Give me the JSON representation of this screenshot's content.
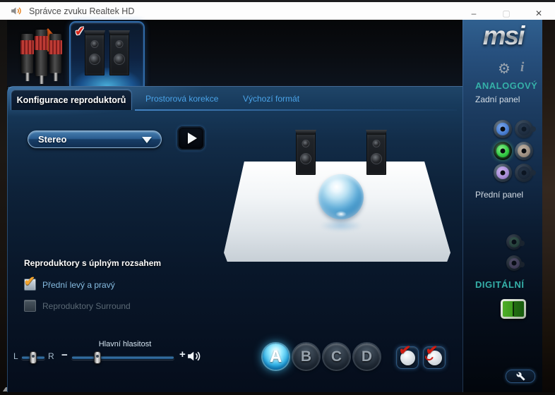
{
  "window": {
    "title": "Správce zvuku Realtek HD",
    "minimize_glyph": "–",
    "maximize_glyph": "▢",
    "close_glyph": "✕"
  },
  "tabs": {
    "speaker_config": "Konfigurace reproduktorů",
    "room_correction": "Prostorová korekce",
    "default_format": "Výchozí formát"
  },
  "speaker_config": {
    "channel_mode": "Stereo",
    "full_range_heading": "Reproduktory s úplným rozsahem",
    "option_front": "Přední levý a pravý",
    "option_front_checked": true,
    "option_surround": "Reproduktory Surround",
    "option_surround_checked": false
  },
  "volume": {
    "balance_left": "L",
    "balance_right": "R",
    "balance_percent": 50,
    "main_label": "Hlavní hlasitost",
    "decrease_glyph": "−",
    "increase_glyph": "+",
    "main_percent": 25
  },
  "speaker_test": {
    "button_a": "A",
    "button_b": "B",
    "button_c": "C",
    "button_d": "D",
    "active": "A"
  },
  "sidebar": {
    "brand": "msi",
    "settings_glyph": "⚙",
    "info_glyph": "i",
    "analog_heading": "ANALOGOVÝ",
    "rear_panel": "Zadní panel",
    "front_panel": "Přední panel",
    "digital_heading": "DIGITÁLNÍ"
  },
  "colors": {
    "accent_teal": "#35b0a8",
    "tab_link_blue": "#4aa3e8",
    "check_orange": "#f2a32e",
    "test_active_cyan": "#31b5ea",
    "jack_blue": "#4a80d4",
    "jack_green": "#35cc45",
    "jack_tan": "#9a8d80",
    "jack_violet": "#a98fd8",
    "optical_green": "#3d9a1e",
    "alert_red": "#cf1d12"
  }
}
